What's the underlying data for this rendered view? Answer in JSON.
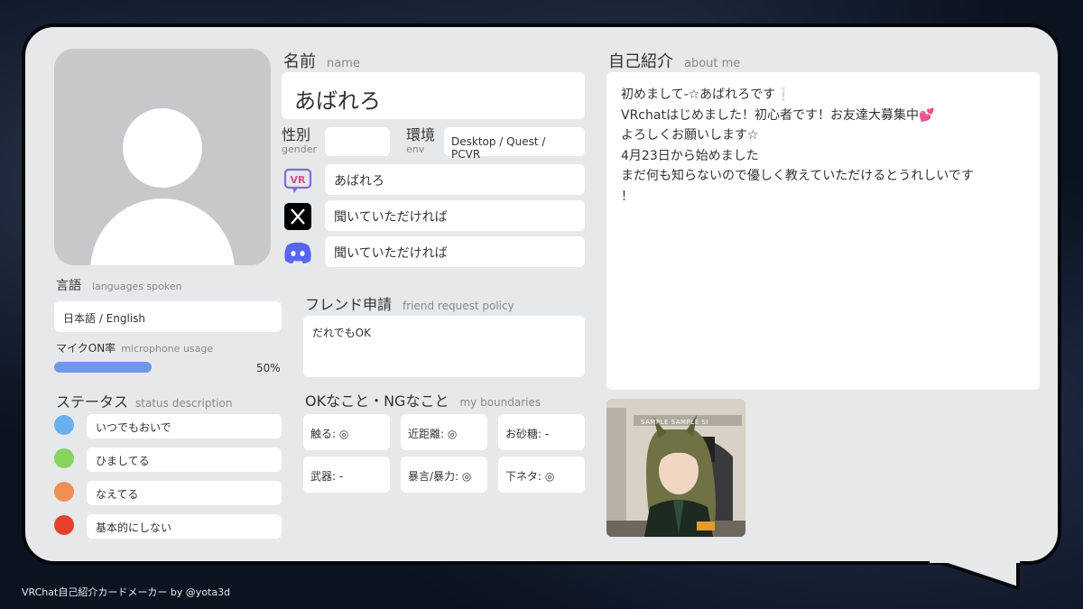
{
  "profile": {
    "name_label_jp": "名前",
    "name_label_en": "name",
    "name_value": "あばれろ",
    "gender_label_jp": "性別",
    "gender_label_en": "gender",
    "gender_value": "",
    "env_label_jp": "環境",
    "env_label_en": "env",
    "env_value": "Desktop / Quest / PCVR",
    "vrchat_id": "あばれろ",
    "x_id": "聞いていただければ",
    "discord_id": "聞いていただければ"
  },
  "languages": {
    "label_jp": "言語",
    "label_en": "languages spoken",
    "value": "日本語 / English"
  },
  "mic": {
    "label_jp": "マイクON率",
    "label_en": "microphone usage",
    "percent_text": "50%",
    "percent": 50
  },
  "status": {
    "label_jp": "ステータス",
    "label_en": "status description",
    "items": [
      {
        "color": "#6ab0ee",
        "text": "いつでもおいで"
      },
      {
        "color": "#86d45c",
        "text": "ひましてる"
      },
      {
        "color": "#f09050",
        "text": "なえてる"
      },
      {
        "color": "#e8402e",
        "text": "基本的にしない"
      }
    ]
  },
  "friend": {
    "label_jp": "フレンド申請",
    "label_en": "friend request policy",
    "value": "だれでもOK"
  },
  "boundaries": {
    "label_jp": "OKなこと・NGなこと",
    "label_en": "my boundaries",
    "items": [
      "触る: ◎",
      "近距離: ◎",
      "お砂糖: -",
      "武器: -",
      "暴言/暴力: ◎",
      "下ネタ: ◎"
    ]
  },
  "about": {
    "label_jp": "自己紹介",
    "label_en": "about me",
    "lines": [
      "初めまして-☆あばれろです❕",
      "VRchatはじめました！初心者です！お友達大募集中💕",
      "よろしくお願いします☆",
      "4月23日から始めました",
      "まだ何も知らないので優しく教えていただけるとうれしいです",
      "！"
    ]
  },
  "photo": {
    "sign_text": "SAMPLE SAMPLE SI"
  },
  "footer": "VRChat自己紹介カードメーカー by @yota3d",
  "colors": {
    "mic_bar": "#6f96e8",
    "discord": "#5865f2",
    "vrchat": "#7b6fd6"
  }
}
